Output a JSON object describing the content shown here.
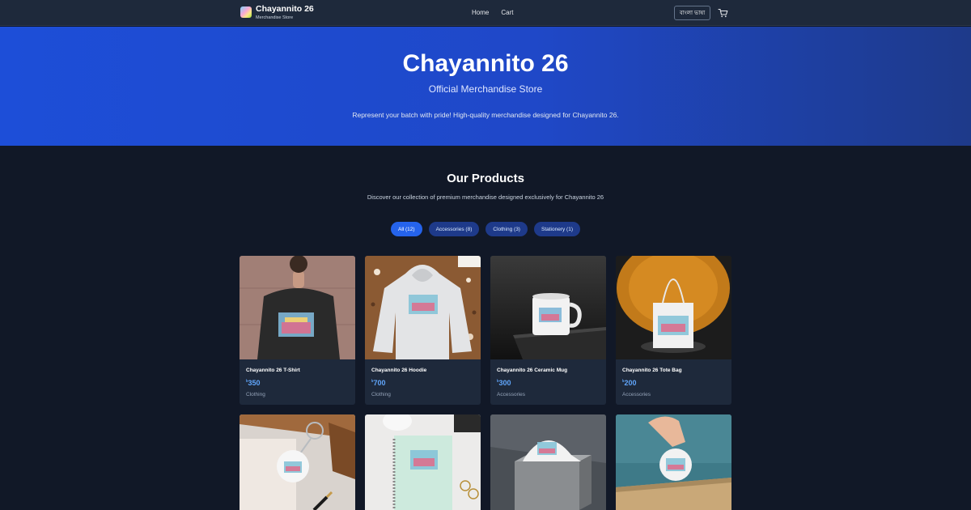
{
  "nav": {
    "brand_title": "Chayannito 26",
    "brand_subtitle": "Merchandise Store",
    "links": [
      "Home",
      "Cart"
    ],
    "language_button": "বাংলা ভাষা",
    "cart_icon": "cart-icon"
  },
  "hero": {
    "title": "Chayannito 26",
    "subtitle": "Official Merchandise Store",
    "description": "Represent your batch with pride! High-quality merchandise designed for Chayannito 26."
  },
  "products_section": {
    "title": "Our Products",
    "subtitle": "Discover our collection of premium merchandise designed exclusively for Chayannito 26"
  },
  "filters": [
    {
      "label": "All (12)",
      "active": true
    },
    {
      "label": "Accessories (8)",
      "active": false
    },
    {
      "label": "Clothing (3)",
      "active": false
    },
    {
      "label": "Stationery (1)",
      "active": false
    }
  ],
  "currency_symbol": "৳",
  "products": [
    {
      "name": "Chayannito 26 T-Shirt",
      "price": "350",
      "category": "Clothing"
    },
    {
      "name": "Chayannito 26 Hoodie",
      "price": "700",
      "category": "Clothing"
    },
    {
      "name": "Chayannito 26 Ceramic Mug",
      "price": "300",
      "category": "Accessories"
    },
    {
      "name": "Chayannito 26 Tote Bag",
      "price": "200",
      "category": "Accessories"
    }
  ],
  "colors": {
    "accent": "#2563eb",
    "price": "#60a5fa",
    "background": "#111827",
    "card": "#1e293b"
  }
}
